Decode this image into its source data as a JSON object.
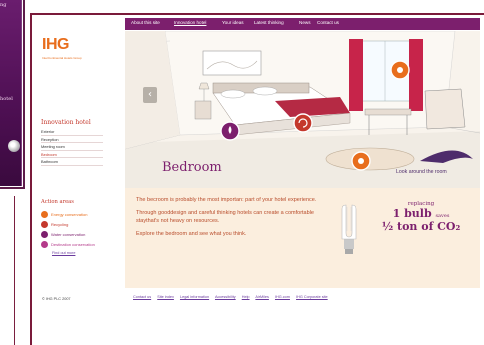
{
  "promo": {
    "text_top": "ng",
    "text_mid": "hotel"
  },
  "nav": {
    "items": [
      {
        "label": "About this site",
        "active": false
      },
      {
        "label": "Innovation hotel",
        "active": true
      },
      {
        "label": "Your ideas",
        "active": false
      },
      {
        "label": "Latest thinking",
        "active": false
      },
      {
        "label": "News",
        "active": false
      },
      {
        "label": "Contact us",
        "active": false
      }
    ]
  },
  "logo": {
    "mark": "IHG",
    "subtitle": "InterContinental Hotels Group"
  },
  "section": {
    "title": "Innovation hotel",
    "items": [
      {
        "label": "Exterior",
        "active": false
      },
      {
        "label": "Reception",
        "active": false
      },
      {
        "label": "Meeting room",
        "active": false
      },
      {
        "label": "Bedroom",
        "active": true
      },
      {
        "label": "Bathroom",
        "active": false
      }
    ]
  },
  "actions": {
    "title": "Action areas",
    "items": [
      {
        "label": "Energy conservation",
        "color": "#e86e1d",
        "text_color": "#e86e1d"
      },
      {
        "label": "Recycling",
        "color": "#c4382c",
        "text_color": "#c4382c"
      },
      {
        "label": "Water conservation",
        "color": "#7c1f6d",
        "text_color": "#7c1f6d"
      },
      {
        "label": "Destination conservation",
        "color": "#b43a8a",
        "text_color": "#b43a8a"
      }
    ],
    "find_out_more": "Find out more"
  },
  "copyright": "© IHG PLC 2007",
  "room": {
    "title": "Bedroom",
    "look_around": "Look around the room",
    "prev_arrow": "‹"
  },
  "info": {
    "paragraphs": [
      "The becroom is probably the most importan: part of your hotel experience.",
      "Through gooddesign and careful thinking hotels can create a comfortable staythat's not heavy on resources.",
      "Explore the bedroom and see what you think."
    ]
  },
  "stat": {
    "line1": "replacing",
    "line2_big": "1 bulb",
    "line2_small": "saves",
    "line3": "½ ton of CO₂"
  },
  "footer": {
    "links": [
      "Contact us",
      "Site index",
      "Legal information",
      "Accessibility",
      "Help",
      "AirMiles",
      "IHG.com",
      "IHG Corporate site"
    ]
  },
  "colors": {
    "brand_purple": "#7c1f6d",
    "brand_orange": "#e86e1d",
    "brand_red": "#c4382c"
  }
}
